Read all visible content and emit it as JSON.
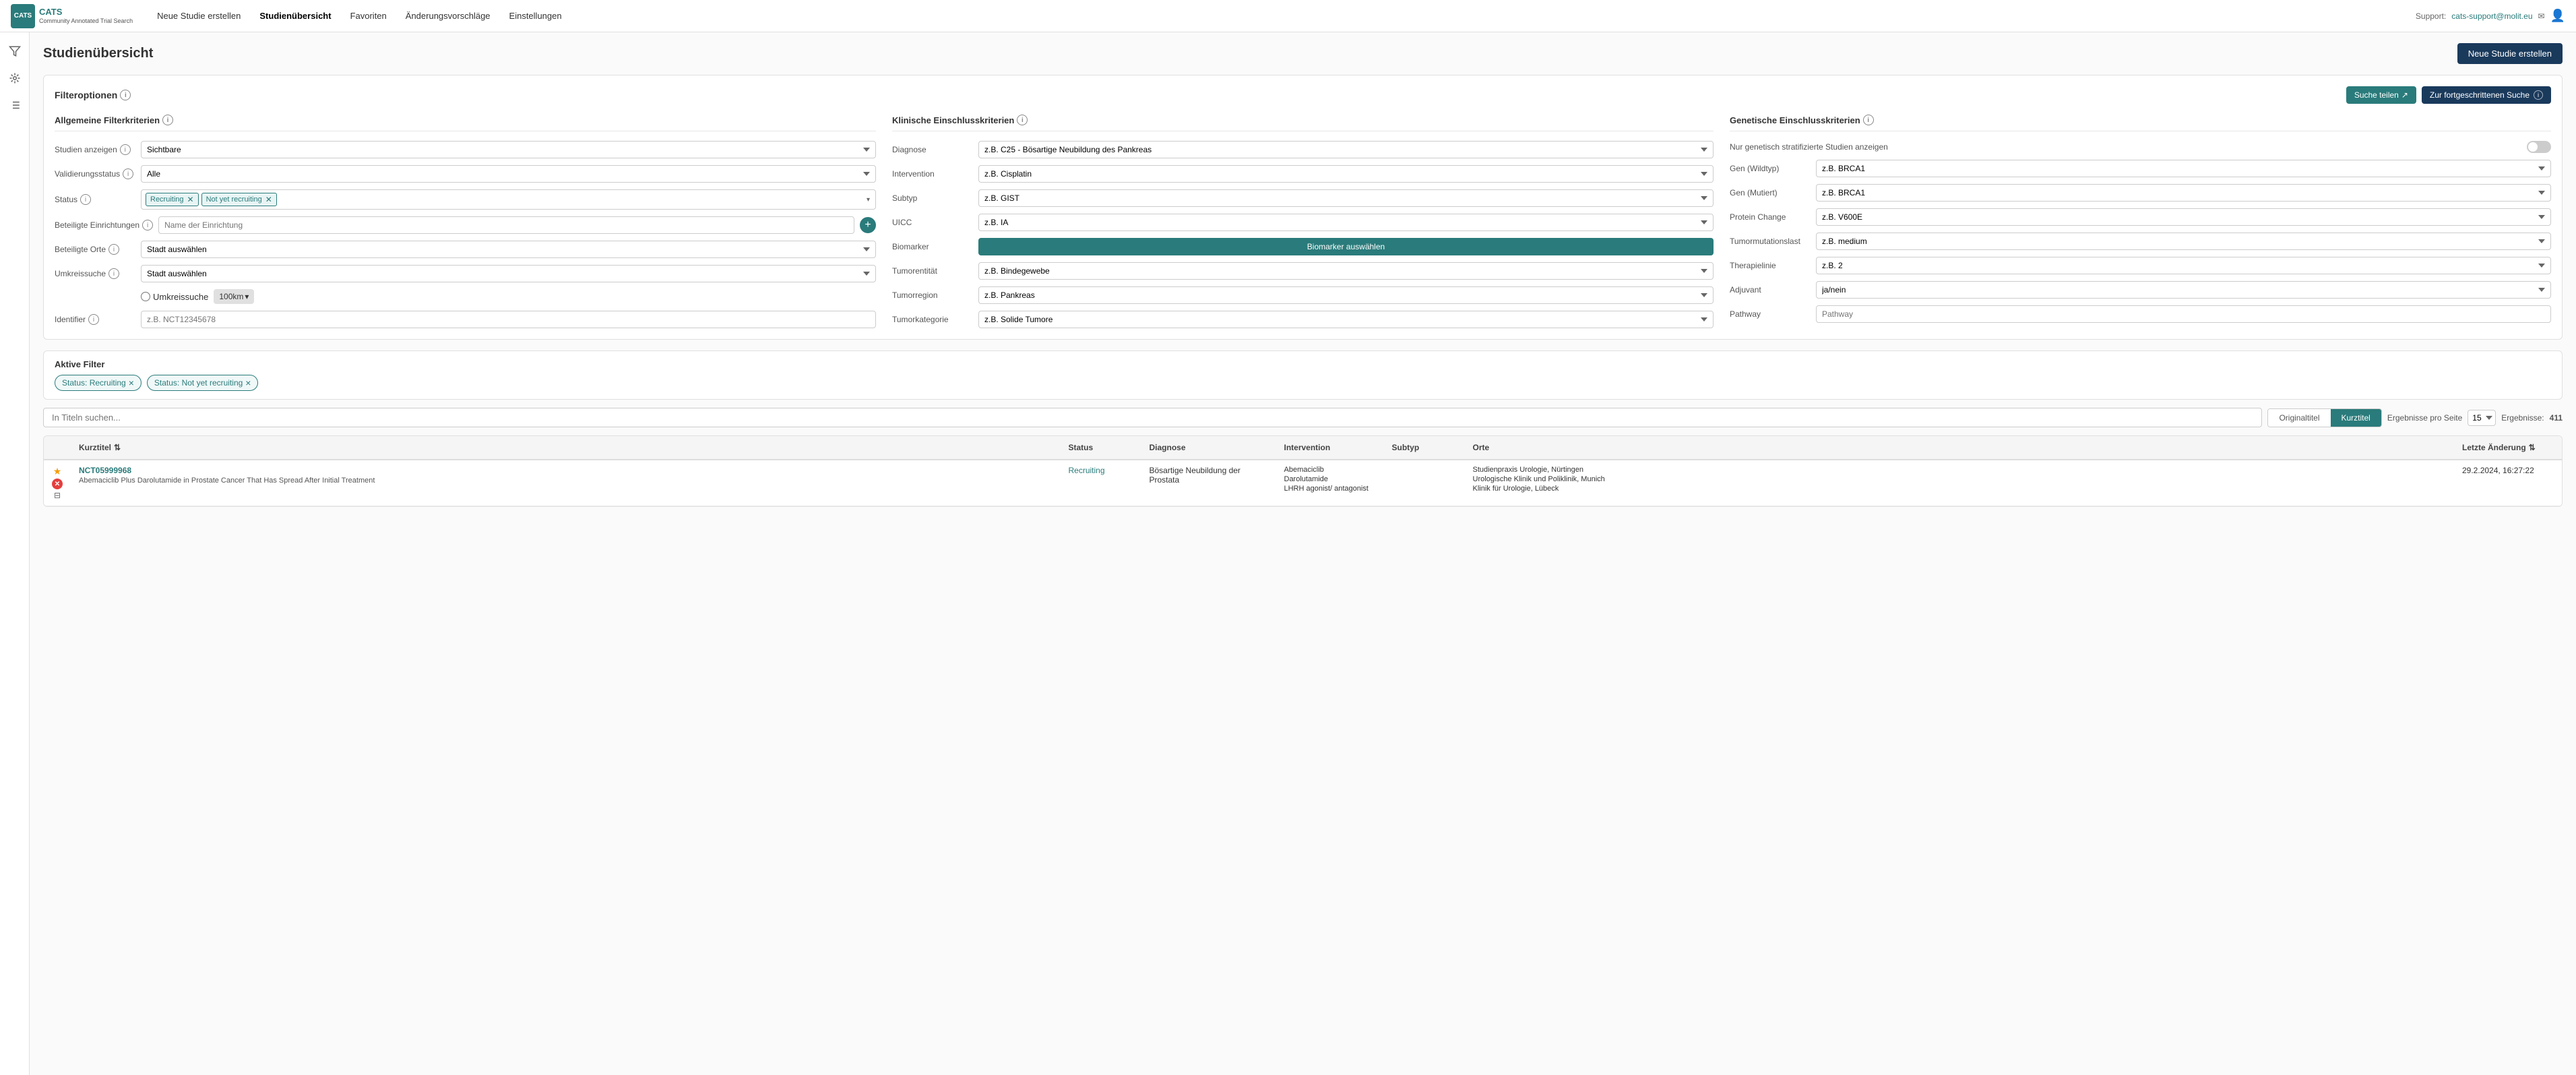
{
  "app": {
    "logo_text": "CATS",
    "logo_subtext": "Community Annotated Trial Search",
    "support_label": "Support:",
    "support_email": "cats-support@molit.eu"
  },
  "nav": {
    "links": [
      {
        "id": "neue-studie",
        "label": "Neue Studie erstellen",
        "active": false
      },
      {
        "id": "studienübersicht",
        "label": "Studienübersicht",
        "active": true
      },
      {
        "id": "favoriten",
        "label": "Favoriten",
        "active": false
      },
      {
        "id": "änderungsvorschläge",
        "label": "Änderungsvorschläge",
        "active": false
      },
      {
        "id": "einstellungen",
        "label": "Einstellungen",
        "active": false
      }
    ]
  },
  "page": {
    "title": "Studienübersicht",
    "new_study_button": "Neue Studie erstellen"
  },
  "filters": {
    "section_title": "Filteroptionen",
    "share_button": "Suche teilen",
    "advanced_button": "Zur fortgeschrittenen Suche",
    "general": {
      "title": "Allgemeine Filterkriterien",
      "fields": [
        {
          "id": "studien-anzeigen",
          "label": "Studien anzeigen",
          "type": "select",
          "value": "Sichtbare",
          "placeholder": ""
        },
        {
          "id": "validierungsstatus",
          "label": "Validierungsstatus",
          "type": "select",
          "value": "Alle",
          "placeholder": ""
        },
        {
          "id": "status",
          "label": "Status",
          "type": "tags",
          "tags": [
            "Recruiting",
            "Not yet recruiting"
          ]
        },
        {
          "id": "beteiligte-einrichtungen",
          "label": "Beteiligte Einrichtungen",
          "type": "input",
          "placeholder": "Name der Einrichtung"
        },
        {
          "id": "beteiligte-orte",
          "label": "Beteiligte Orte",
          "type": "select",
          "value": "",
          "placeholder": "Stadt auswählen"
        },
        {
          "id": "umkreissuche-select",
          "label": "Umkreissuche",
          "type": "select",
          "value": "",
          "placeholder": "Stadt auswählen"
        },
        {
          "id": "umkreissuche-toggle",
          "label": "Umkreissuche",
          "type": "umkreis",
          "km": "100km"
        },
        {
          "id": "identifier",
          "label": "Identifier",
          "type": "input",
          "placeholder": "z.B. NCT12345678"
        }
      ]
    },
    "clinical": {
      "title": "Klinische Einschlusskriterien",
      "fields": [
        {
          "id": "diagnose",
          "label": "Diagnose",
          "placeholder": "z.B. C25 - Bösartige Neubildung des Pankreas"
        },
        {
          "id": "intervention",
          "label": "Intervention",
          "placeholder": "z.B. Cisplatin"
        },
        {
          "id": "subtyp",
          "label": "Subtyp",
          "placeholder": "z.B. GIST"
        },
        {
          "id": "uicc",
          "label": "UICC",
          "placeholder": "z.B. IA"
        },
        {
          "id": "biomarker",
          "label": "Biomarker",
          "type": "button",
          "button_label": "Biomarker auswählen"
        },
        {
          "id": "tumorentität",
          "label": "Tumorentität",
          "placeholder": "z.B. Bindegewebe"
        },
        {
          "id": "tumorregion",
          "label": "Tumorregion",
          "placeholder": "z.B. Pankreas"
        },
        {
          "id": "tumorkategorie",
          "label": "Tumorkategorie",
          "placeholder": "z.B. Solide Tumore"
        }
      ]
    },
    "genetic": {
      "title": "Genetische Einschlusskriterien",
      "fields": [
        {
          "id": "nur-genetisch",
          "label": "Nur genetisch stratifizierte Studien anzeigen",
          "type": "toggle"
        },
        {
          "id": "gen-wildtyp",
          "label": "Gen (Wildtyp)",
          "placeholder": "z.B. BRCA1"
        },
        {
          "id": "gen-mutiert",
          "label": "Gen (Mutiert)",
          "placeholder": "z.B. BRCA1"
        },
        {
          "id": "protein-change",
          "label": "Protein Change",
          "placeholder": "z.B. V600E"
        },
        {
          "id": "tumormutationslast",
          "label": "Tumormutationslast",
          "placeholder": "z.B. medium"
        },
        {
          "id": "therapielinie",
          "label": "Therapielinie",
          "placeholder": "z.B. 2"
        },
        {
          "id": "adjuvant",
          "label": "Adjuvant",
          "placeholder": "ja/nein"
        },
        {
          "id": "pathway",
          "label": "Pathway",
          "type": "input",
          "placeholder": "Pathway"
        }
      ]
    }
  },
  "active_filters": {
    "title": "Aktive Filter",
    "tags": [
      {
        "id": "status-recruiting",
        "label": "Status: Recruiting"
      },
      {
        "id": "status-not-yet",
        "label": "Status: Not yet recruiting"
      }
    ]
  },
  "search": {
    "placeholder": "In Titeln suchen...",
    "tab_original": "Originaltitel",
    "tab_kurz": "Kurztitel",
    "results_per_page_label": "Ergebnisse pro Seite",
    "results_per_page_value": "15",
    "results_total_label": "Ergebnisse:",
    "results_total_value": "411"
  },
  "table": {
    "headers": [
      {
        "id": "icon-col",
        "label": ""
      },
      {
        "id": "kurztitel",
        "label": "Kurztitel",
        "sortable": true
      },
      {
        "id": "status",
        "label": "Status",
        "sortable": false
      },
      {
        "id": "diagnose",
        "label": "Diagnose",
        "sortable": false
      },
      {
        "id": "intervention",
        "label": "Intervention",
        "sortable": false
      },
      {
        "id": "subtyp",
        "label": "Subtyp",
        "sortable": false
      },
      {
        "id": "orte",
        "label": "Orte",
        "sortable": false
      },
      {
        "id": "letzte-aenderung",
        "label": "Letzte Änderung",
        "sortable": true
      }
    ],
    "rows": [
      {
        "id": "NCT05999968",
        "nct": "NCT05999968",
        "kurztitel": "Abemaciclib Plus Darolutamide in Prostate Cancer That Has Spread After Initial Treatment",
        "status": "Recruiting",
        "diagnose": "Bösartige Neubildung der Prostata",
        "interventions": [
          "Abemaciclib",
          "Darolutamide",
          "LHRH agonist/ antagonist"
        ],
        "subtyp": "",
        "orte": [
          "Studienpraxis Urologie, Nürtingen",
          "Urologische Klinik und Poliklinik, Munich",
          "Klinik für Urologie, Lübeck"
        ],
        "letzte_aenderung": "29.2.2024, 16:27:22",
        "starred": true,
        "has_error": true,
        "has_doc": true
      }
    ]
  },
  "icons": {
    "filter_icon": "▼",
    "network_icon": "⬡",
    "list_icon": "☰",
    "share_arrow": "↗",
    "info_circle": "i",
    "sort_up_down": "⇅",
    "star": "★",
    "error_x": "✕",
    "doc": "📄",
    "add_plus": "+",
    "chevron_down": "▾"
  }
}
